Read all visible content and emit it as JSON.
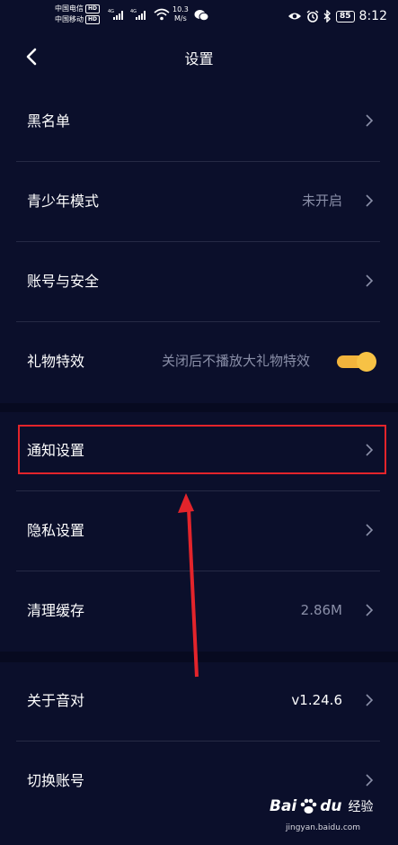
{
  "status_bar": {
    "carrier1": "中国电信",
    "carrier2": "中国移动",
    "hd_badge": "HD",
    "network_type": "4G",
    "speed_value": "10.3",
    "speed_unit": "M/s",
    "battery": "85",
    "time": "8:12",
    "icons": [
      "signal-icon",
      "wifi-icon",
      "wechat-icon",
      "eye-icon",
      "alarm-icon",
      "bluetooth-icon",
      "battery-icon"
    ]
  },
  "header": {
    "title": "设置",
    "back_icon": "back-arrow-icon"
  },
  "settings": [
    {
      "label": "黑名单",
      "value": "",
      "accessory": "chevron"
    },
    {
      "label": "青少年模式",
      "value": "未开启",
      "accessory": "chevron"
    },
    {
      "label": "账号与安全",
      "value": "",
      "accessory": "chevron"
    },
    {
      "label": "礼物特效",
      "value": "关闭后不播放大礼物特效",
      "accessory": "toggle",
      "toggle_on": true
    },
    {
      "label": "通知设置",
      "value": "",
      "accessory": "chevron",
      "highlighted": true
    },
    {
      "label": "隐私设置",
      "value": "",
      "accessory": "chevron"
    },
    {
      "label": "清理缓存",
      "value": "2.86M",
      "accessory": "chevron"
    },
    {
      "label": "关于音对",
      "value": "v1.24.6",
      "accessory": "chevron"
    },
    {
      "label": "切换账号",
      "value": "",
      "accessory": "chevron"
    }
  ],
  "colors": {
    "background": "#0b0f2b",
    "divider": "#262a45",
    "toggle_on": "#f7c245",
    "annotation_red": "#e3242b"
  },
  "watermark": {
    "brand_left": "Bai",
    "brand_right": "du",
    "suffix": "经验",
    "url": "jingyan.baidu.com"
  }
}
